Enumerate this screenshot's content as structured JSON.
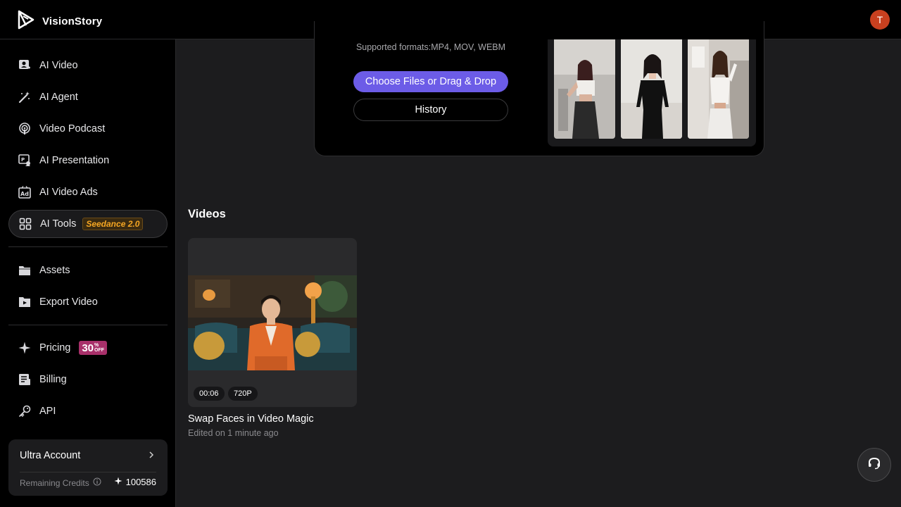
{
  "app": {
    "name": "VisionStory",
    "avatar_initial": "T"
  },
  "sidebar": {
    "items": [
      {
        "label": "AI Video",
        "icon": "ai-video-icon"
      },
      {
        "label": "AI Agent",
        "icon": "magic-wand-icon"
      },
      {
        "label": "Video Podcast",
        "icon": "podcast-icon"
      },
      {
        "label": "AI Presentation",
        "icon": "presentation-icon"
      },
      {
        "label": "AI Video Ads",
        "icon": "ad-icon"
      },
      {
        "label": "AI Tools",
        "icon": "grid-icon",
        "badge": "Seedance 2.0",
        "active": true
      },
      {
        "label": "Assets",
        "icon": "folder-icon"
      },
      {
        "label": "Export Video",
        "icon": "export-video-icon"
      },
      {
        "label": "Pricing",
        "icon": "sparkle-icon",
        "badge_num": "30",
        "badge_top": "%",
        "badge_bottom": "OFF"
      },
      {
        "label": "Billing",
        "icon": "receipt-icon"
      },
      {
        "label": "API",
        "icon": "key-icon"
      }
    ],
    "account": {
      "title": "Ultra Account",
      "credits_label": "Remaining Credits",
      "credits_value": "100586"
    }
  },
  "upload": {
    "formats": "Supported formats:MP4, MOV, WEBM",
    "choose_label": "Choose Files or Drag & Drop",
    "history_label": "History"
  },
  "videos": {
    "section_title": "Videos",
    "items": [
      {
        "title": "Swap Faces in Video Magic",
        "meta": "Edited on 1 minute ago",
        "duration": "00:06",
        "resolution": "720P"
      }
    ]
  },
  "colors": {
    "accent": "#6c5ce7",
    "avatar": "#c8401f",
    "badge_seed": "#f5a623",
    "badge_off": "#a8306a"
  }
}
